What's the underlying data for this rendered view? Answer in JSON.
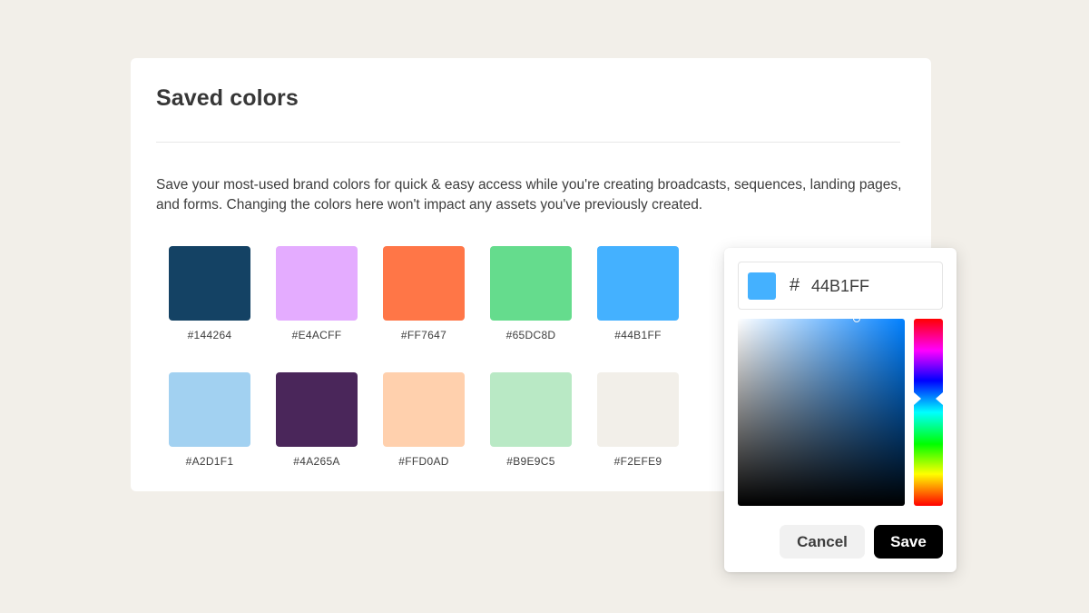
{
  "card": {
    "title": "Saved colors",
    "description": "Save your most-used brand colors for quick & easy access while you're creating broadcasts, sequences, landing pages, and forms. Changing the colors here won't impact any assets you've previously created."
  },
  "swatches": [
    {
      "hex": "#144264",
      "label": "#144264"
    },
    {
      "hex": "#E4ACFF",
      "label": "#E4ACFF"
    },
    {
      "hex": "#FF7647",
      "label": "#FF7647"
    },
    {
      "hex": "#65DC8D",
      "label": "#65DC8D"
    },
    {
      "hex": "#44B1FF",
      "label": "#44B1FF"
    },
    {
      "hex": "#A2D1F1",
      "label": "#A2D1F1"
    },
    {
      "hex": "#4A265A",
      "label": "#4A265A"
    },
    {
      "hex": "#FFD0AD",
      "label": "#FFD0AD"
    },
    {
      "hex": "#B9E9C5",
      "label": "#B9E9C5"
    },
    {
      "hex": "#F2EFE9",
      "label": "#F2EFE9"
    }
  ],
  "picker": {
    "preview_color": "#44B1FF",
    "hash": "#",
    "hex_value": "44B1FF",
    "cancel_label": "Cancel",
    "save_label": "Save"
  }
}
